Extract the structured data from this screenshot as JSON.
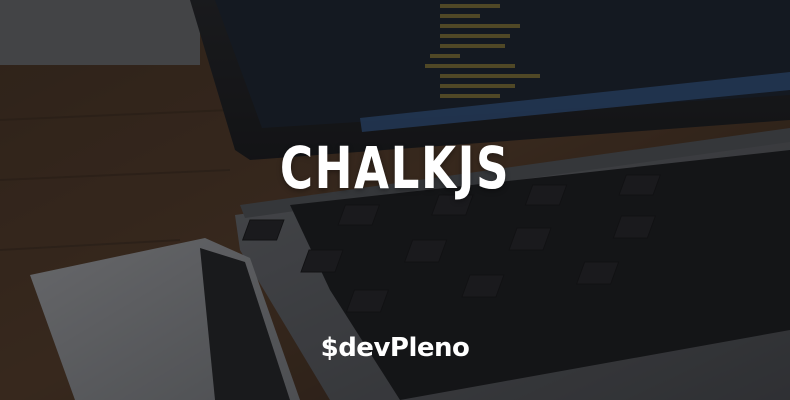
{
  "banner": {
    "title": "CHALKJS",
    "logo_text": "$devPleno"
  },
  "background": {
    "subject": "laptop-with-code-editor-and-smartphone-on-wooden-desk",
    "overlay_color": "#0c0c0e"
  },
  "colors": {
    "title": "#ffffff",
    "logo": "#ffffff"
  }
}
